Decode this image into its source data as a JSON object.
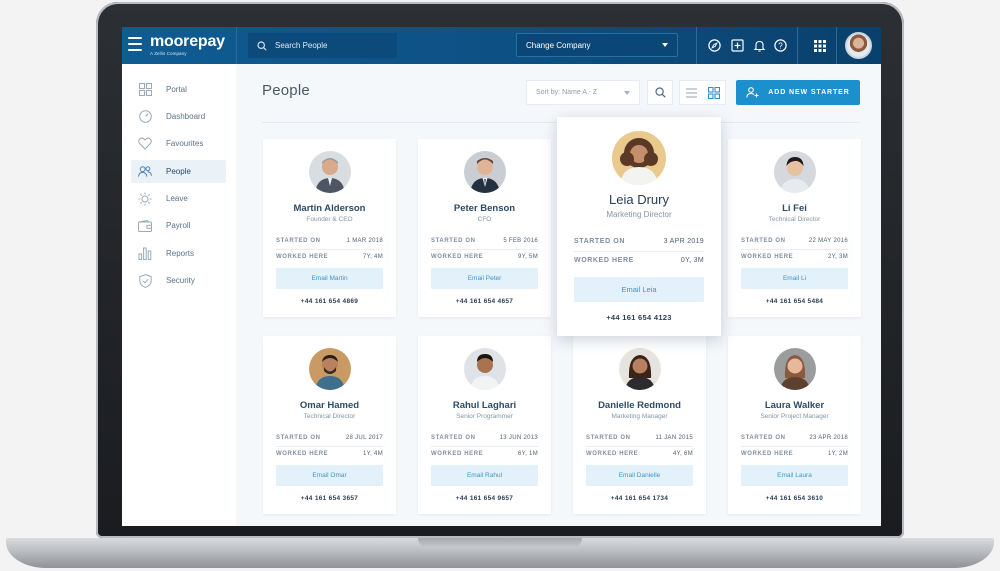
{
  "app": {
    "logo_name": "moorepay",
    "logo_sub": "A Zellis Company"
  },
  "header": {
    "search_placeholder": "Search People",
    "company_select": "Change Company",
    "icons": [
      "compass-icon",
      "plus-square-icon",
      "bell-icon",
      "help-icon",
      "apps-grid-icon"
    ]
  },
  "sidebar": {
    "items": [
      {
        "label": "Portal",
        "icon": "portal-grid-icon"
      },
      {
        "label": "Dashboard",
        "icon": "gauge-icon"
      },
      {
        "label": "Favourites",
        "icon": "heart-icon"
      },
      {
        "label": "People",
        "icon": "people-icon",
        "active": true
      },
      {
        "label": "Leave",
        "icon": "sun-icon"
      },
      {
        "label": "Payroll",
        "icon": "wallet-icon"
      },
      {
        "label": "Reports",
        "icon": "bar-chart-icon"
      },
      {
        "label": "Security",
        "icon": "shield-icon"
      }
    ]
  },
  "main": {
    "title": "People",
    "sort_label": "Sort by: Name A - Z",
    "add_button": "ADD NEW STARTER",
    "labels": {
      "started_on": "STARTED ON",
      "worked_here": "WORKED HERE"
    }
  },
  "people": [
    {
      "name": "Martin Alderson",
      "role": "Founder & CEO",
      "started": "1 MAR 2018",
      "worked": "7Y, 4M",
      "email": "Email Martin",
      "phone": "+44 161 654 4869"
    },
    {
      "name": "Peter Benson",
      "role": "CFO",
      "started": "5 FEB 2016",
      "worked": "9Y, 5M",
      "email": "Email Peter",
      "phone": "+44 161 654 4657"
    },
    {
      "name": "Leia Drury",
      "role": "Marketing Director",
      "started": "3 APR 2019",
      "worked": "0Y, 3M",
      "email": "Email Leia",
      "phone": "+44 161 654 4123"
    },
    {
      "name": "Li Fei",
      "role": "Technical Director",
      "started": "22 MAY 2016",
      "worked": "2Y, 3M",
      "email": "Email Li",
      "phone": "+44 161 654 5484"
    },
    {
      "name": "Omar Hamed",
      "role": "Technical Director",
      "started": "28 JUL 2017",
      "worked": "1Y, 4M",
      "email": "Email Omar",
      "phone": "+44 161 654 3657"
    },
    {
      "name": "Rahul Laghari",
      "role": "Senior Programmer",
      "started": "13 JUN 2013",
      "worked": "6Y, 1M",
      "email": "Email Rahul",
      "phone": "+44 161 654 9657"
    },
    {
      "name": "Danielle Redmond",
      "role": "Marketing Manager",
      "started": "11 JAN 2015",
      "worked": "4Y, 6M",
      "email": "Email Danielle",
      "phone": "+44 161 654 1734"
    },
    {
      "name": "Laura Walker",
      "role": "Senior Project Manager",
      "started": "23 APR 2018",
      "worked": "1Y, 2M",
      "email": "Email Laura",
      "phone": "+44 161 654 3610"
    }
  ],
  "colors": {
    "header_bg": "#0d4f82",
    "accent": "#1c8fcd",
    "email_btn_bg": "#e3f1fa"
  }
}
